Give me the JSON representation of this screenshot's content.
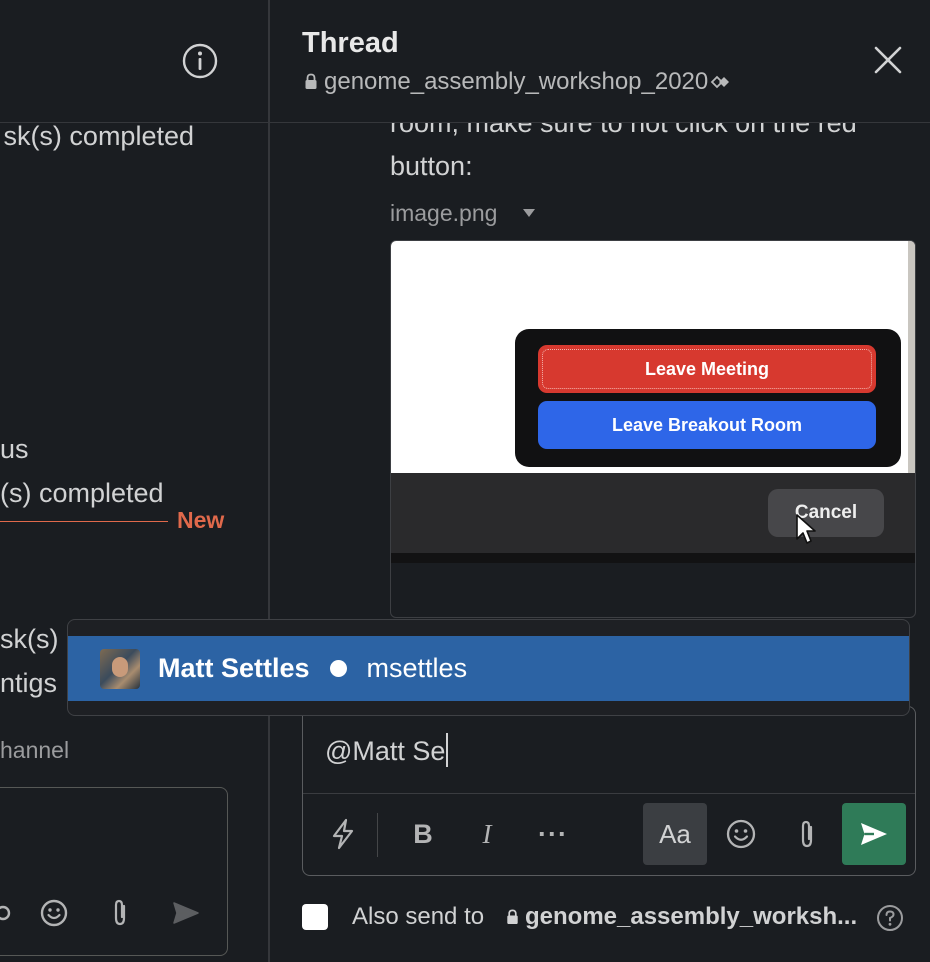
{
  "left_pane": {
    "text_1": "sk(s) completed",
    "text_2": "us",
    "text_3": "(s) completed",
    "new_label": "New",
    "text_4": "sk(s) c",
    "text_5": "ntigs",
    "text_6": "hannel"
  },
  "thread": {
    "title": "Thread",
    "channel": "genome_assembly_workshop_2020",
    "close_icon": "close-icon"
  },
  "message": {
    "line_1": "room, make sure to not click on the red",
    "line_2": "button:",
    "file_name": "image.png",
    "screenshot": {
      "leave_meeting": "Leave Meeting",
      "leave_breakout": "Leave Breakout Room",
      "cancel": "Cancel"
    }
  },
  "mention": {
    "name": "Matt Settles",
    "handle": "msettles",
    "status": "active"
  },
  "composer": {
    "value": "@Matt Se",
    "toolbar": {
      "shortcuts_icon": "lightning-icon",
      "bold": "B",
      "italic": "I",
      "more": "···",
      "format_toggle": "Aa",
      "emoji_icon": "emoji-icon",
      "attach_icon": "paperclip-icon",
      "send_icon": "send-icon"
    },
    "send_color": "#2f7b58"
  },
  "also_send": {
    "label": "Also send to",
    "channel": "genome_assembly_worksh...",
    "checked": false
  },
  "colors": {
    "background": "#1a1d21",
    "new_divider": "#e0694b",
    "mention_highlight": "#2c63a4"
  }
}
